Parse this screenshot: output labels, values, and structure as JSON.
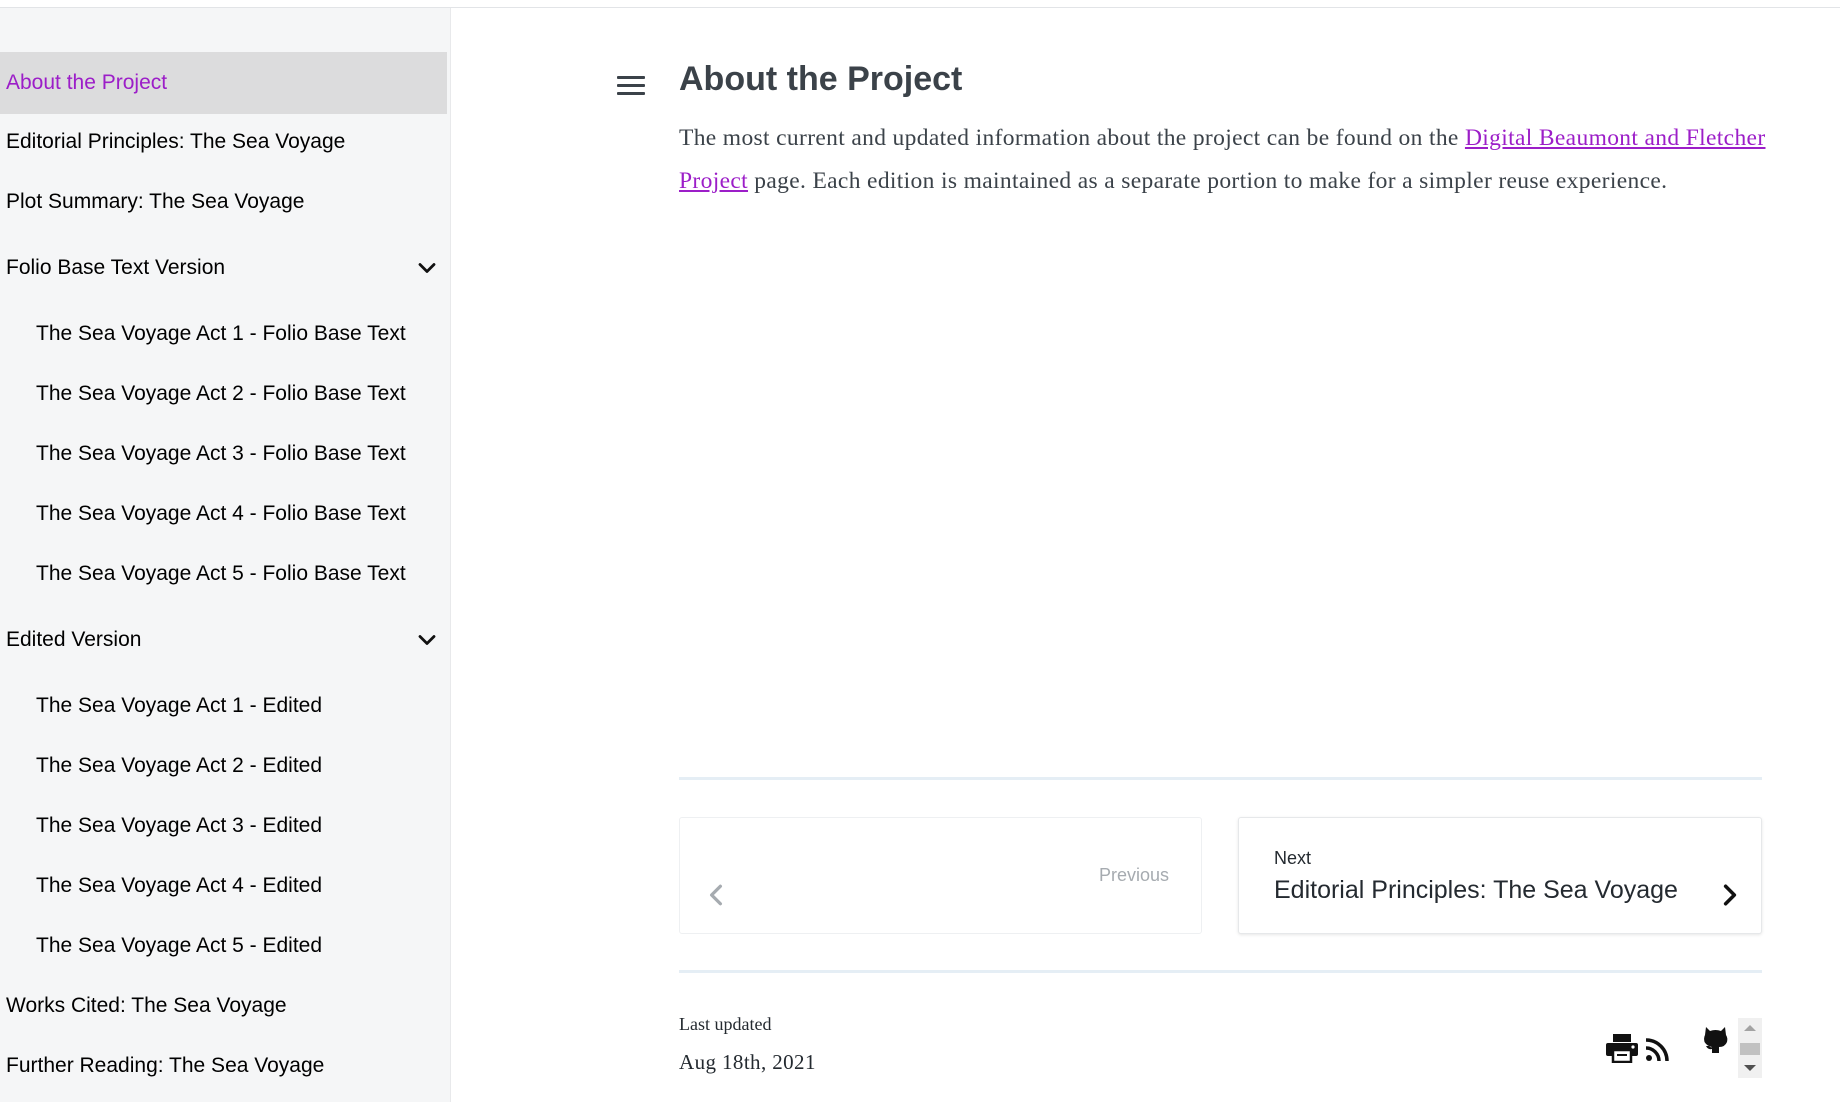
{
  "sidebar": {
    "items": [
      {
        "label": "About the Project",
        "active": true
      },
      {
        "label": "Editorial Principles: The Sea Voyage"
      },
      {
        "label": "Plot Summary: The Sea Voyage"
      },
      {
        "label": "Folio Base Text Version",
        "expandable": true,
        "expanded": true,
        "icon": "chevron-down-icon"
      },
      {
        "label": "The Sea Voyage Act 1 - Folio Base Text",
        "child": true
      },
      {
        "label": "The Sea Voyage Act 2 - Folio Base Text",
        "child": true
      },
      {
        "label": "The Sea Voyage Act 3 - Folio Base Text",
        "child": true
      },
      {
        "label": "The Sea Voyage Act 4 - Folio Base Text",
        "child": true
      },
      {
        "label": "The Sea Voyage Act 5 - Folio Base Text",
        "child": true
      },
      {
        "label": "Edited Version",
        "expandable": true,
        "expanded": true,
        "icon": "chevron-down-icon"
      },
      {
        "label": "The Sea Voyage Act 1 - Edited",
        "child": true
      },
      {
        "label": "The Sea Voyage Act 2 - Edited",
        "child": true
      },
      {
        "label": "The Sea Voyage Act 3 - Edited",
        "child": true
      },
      {
        "label": "The Sea Voyage Act 4 - Edited",
        "child": true
      },
      {
        "label": "The Sea Voyage Act 5 - Edited",
        "child": true
      },
      {
        "label": "Works Cited: The Sea Voyage"
      },
      {
        "label": "Further Reading: The Sea Voyage"
      }
    ]
  },
  "main": {
    "menu_icon": "hamburger-menu-icon",
    "title": "About the Project",
    "paragraph": {
      "before": "The most current and updated information about the project can be found on the ",
      "link": "Digital Beaumont and Fletcher Project",
      "after": " page. Each edition is maintained as a separate portion to make for a simpler reuse experience."
    }
  },
  "pagination": {
    "previous": {
      "label": "Previous",
      "icon": "chevron-left-icon"
    },
    "next": {
      "label": "Next",
      "title": "Editorial Principles: The Sea Voyage",
      "icon": "chevron-right-icon"
    }
  },
  "footer": {
    "last_updated_label": "Last updated",
    "last_updated_date": "Aug 18th, 2021",
    "icons": [
      "print-icon",
      "rss-icon",
      "github-icon"
    ]
  },
  "colors": {
    "accent": "#9c1ec8",
    "heading": "#3b4249",
    "sidebar_bg": "#f5f6f7",
    "active_bg": "#dcdcdd"
  }
}
